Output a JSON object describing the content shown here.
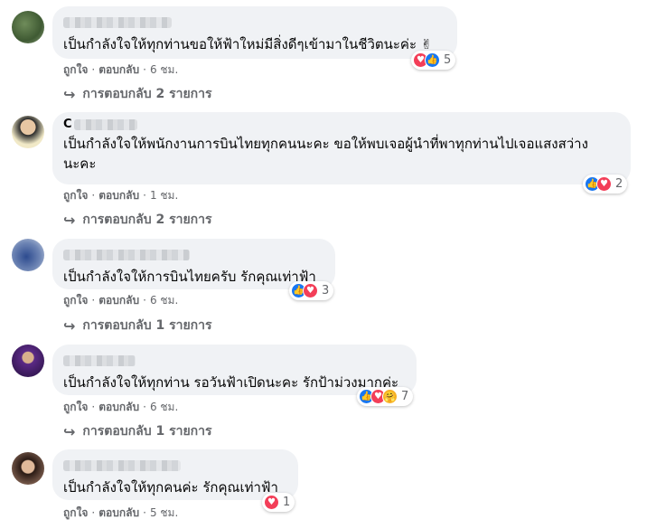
{
  "comments": [
    {
      "text": "เป็นกำลังใจให้ทุกท่านขอให้ฟ้าใหม่มีสิ่งดีๆเข้ามาในชีวิตนะค่ะ ✌",
      "reaction_count": "5",
      "reactions": [
        "heart",
        "like"
      ],
      "like": "ถูกใจ",
      "reply": "ตอบกลับ",
      "time": "6 ชม.",
      "replies_label": "การตอบกลับ 2 รายการ"
    },
    {
      "name_visible": "C",
      "text": "เป็นกำลังใจให้พนักงานการบินไทยทุกคนนะคะ ขอให้พบเจอผู้นำที่พาทุกท่านไปเจอแสงสว่าง นะคะ",
      "reaction_count": "2",
      "reactions": [
        "like",
        "heart"
      ],
      "like": "ถูกใจ",
      "reply": "ตอบกลับ",
      "time": "1 ชม.",
      "replies_label": "การตอบกลับ 2 รายการ"
    },
    {
      "text": "เป็นกำลังใจให้การบินไทยครับ รักคุณเท่าฟ้า",
      "reaction_count": "3",
      "reactions": [
        "like",
        "heart"
      ],
      "like": "ถูกใจ",
      "reply": "ตอบกลับ",
      "time": "6 ชม.",
      "replies_label": "การตอบกลับ 1 รายการ"
    },
    {
      "text": "เป็นกำลังใจให้ทุกท่าน รอวันฟ้าเปิดนะคะ รักป้าม่วงมากค่ะ",
      "reaction_count": "7",
      "reactions": [
        "like",
        "heart",
        "care"
      ],
      "like": "ถูกใจ",
      "reply": "ตอบกลับ",
      "time": "6 ชม.",
      "replies_label": "การตอบกลับ 1 รายการ"
    },
    {
      "text": "เป็นกำลังใจให้ทุกคนค่ะ รักคุณเท่าฟ้า",
      "reaction_count": "1",
      "reactions": [
        "heart"
      ],
      "like": "ถูกใจ",
      "reply": "ตอบกลับ",
      "time": "5 ชม."
    }
  ],
  "colors": {
    "bubble": "#f0f2f5",
    "secondary_text": "#65676b",
    "like_blue": "#1877f2",
    "love_red": "#f33e58",
    "care_yellow": "#f7b125"
  },
  "icons": {
    "heart": "♥",
    "like": "👍",
    "care": "🤗",
    "reply_arrow": "↪"
  }
}
